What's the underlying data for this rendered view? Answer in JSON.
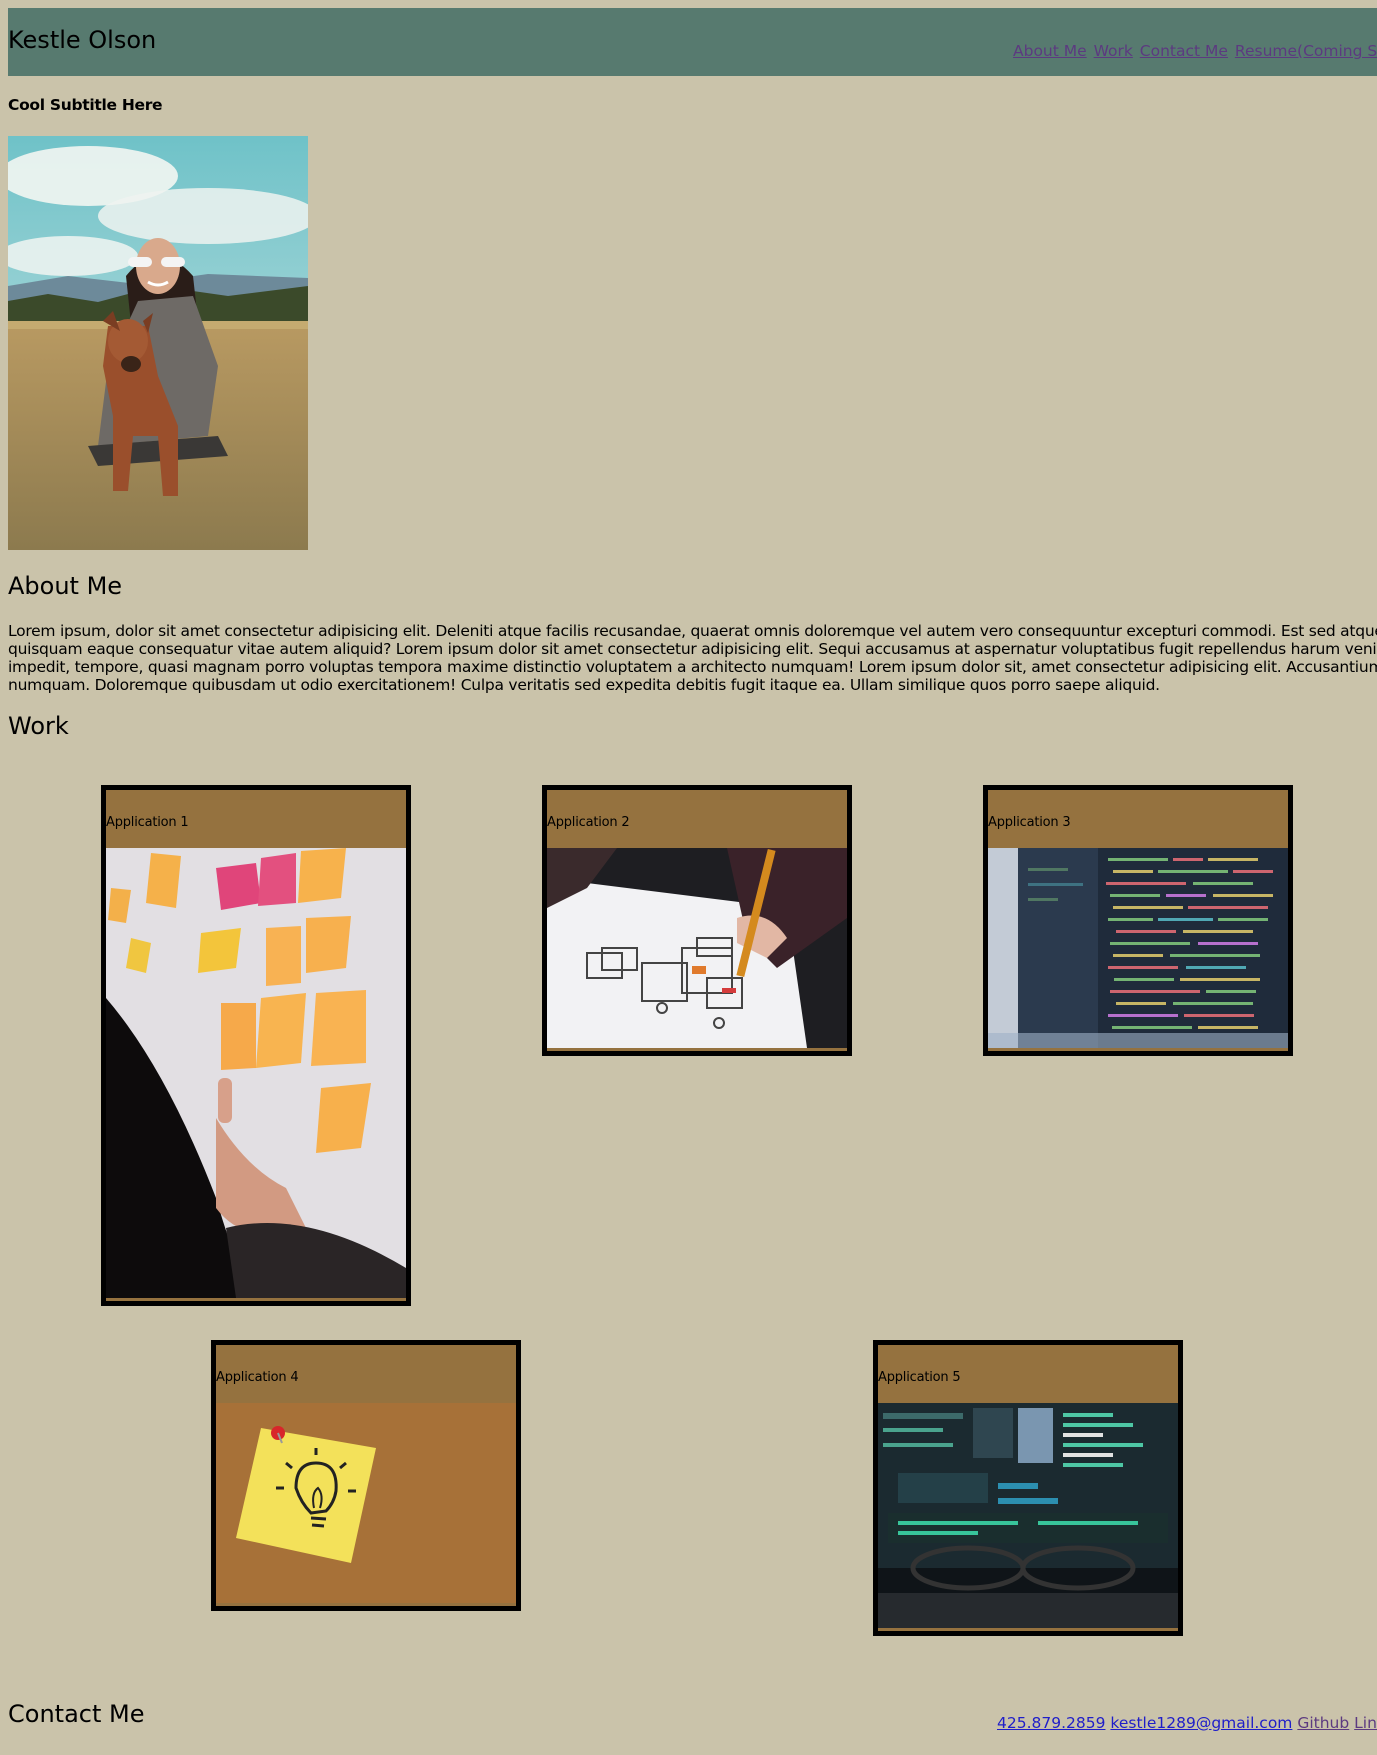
{
  "header": {
    "title": "Kestle Olson",
    "nav": [
      "About Me",
      "Work",
      "Contact Me",
      "Resume(Coming Soon)"
    ]
  },
  "subtitle": "Cool Subtitle Here",
  "about": {
    "heading": "About Me",
    "lines": [
      "Lorem ipsum, dolor sit amet consectetur adipisicing elit. Deleniti atque facilis recusandae, quaerat omnis doloremque vel autem vero consequuntur excepturi commodi. Est sed atque",
      "quisquam eaque consequatur vitae autem aliquid? Lorem ipsum dolor sit amet consectetur adipisicing elit. Sequi accusamus at aspernatur voluptatibus fugit repellendus harum veniam",
      "impedit, tempore, quasi magnam porro voluptas tempora maxime distinctio voluptatem a architecto numquam! Lorem ipsum dolor sit, amet consectetur adipisicing elit. Accusantium, pariatur",
      "numquam. Doloremque quibusdam ut odio exercitationem! Culpa veritatis sed expedita debitis fugit itaque ea. Ullam similique quos porro saepe aliquid."
    ]
  },
  "work": {
    "heading": "Work",
    "cards": [
      {
        "label": "Application 1",
        "image": "sticky-notes-wall"
      },
      {
        "label": "Application 2",
        "image": "wireframe-sketch"
      },
      {
        "label": "Application 3",
        "image": "code-screen"
      },
      {
        "label": "Application 4",
        "image": "lightbulb-sticky-note"
      },
      {
        "label": "Application 5",
        "image": "monitor-with-glasses"
      }
    ]
  },
  "contact": {
    "heading": "Contact Me",
    "phone": "425.879.2859",
    "email": "kestle1289@gmail.com",
    "github": "Github",
    "linkedin": "LinkedIn"
  },
  "colors": {
    "background": "#cac3aa",
    "header": "#577a6f",
    "card_border": "#000000",
    "card_fill": "#95723f",
    "link": "#1f1ec9",
    "visited_link": "#5c3a80"
  }
}
